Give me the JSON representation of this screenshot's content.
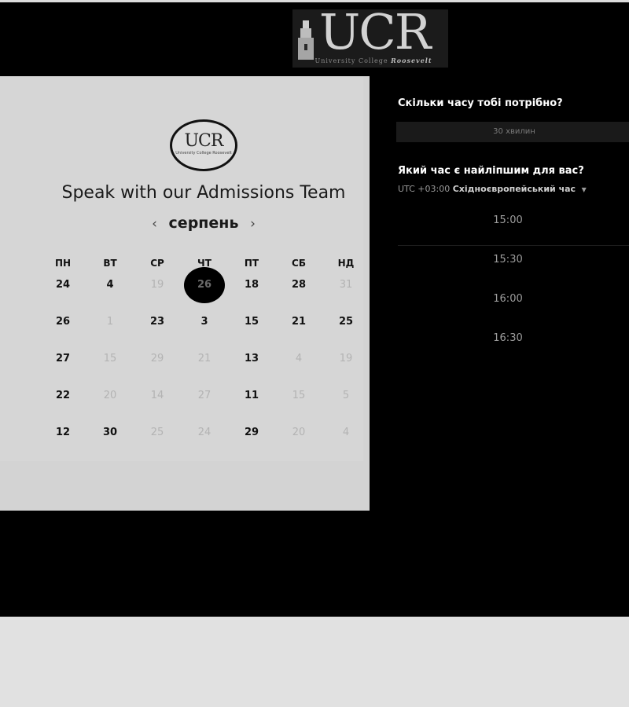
{
  "header": {
    "logo_text": "UCR",
    "logo_subtitle": "University College",
    "logo_subtitle_script": "Roosevelt"
  },
  "calendar": {
    "logo_text": "UCR",
    "logo_subtitle": "University College Roosevelt",
    "title": "Speak with our Admissions Team",
    "month": "серпень",
    "prev_icon": "chevron-left-icon",
    "next_icon": "chevron-right-icon",
    "prev_glyph": "‹",
    "next_glyph": "›",
    "weekdays": [
      "ПН",
      "ВТ",
      "СР",
      "ЧТ",
      "ПТ",
      "СБ",
      "НД"
    ],
    "weeks": [
      [
        {
          "d": "24",
          "a": true
        },
        {
          "d": "4",
          "a": true
        },
        {
          "d": "19",
          "a": false
        },
        {
          "d": "26",
          "a": true,
          "selected": true
        },
        {
          "d": "18",
          "a": true
        },
        {
          "d": "28",
          "a": true
        },
        {
          "d": "31",
          "a": false
        }
      ],
      [
        {
          "d": "26",
          "a": true
        },
        {
          "d": "1",
          "a": false
        },
        {
          "d": "23",
          "a": true
        },
        {
          "d": "3",
          "a": true
        },
        {
          "d": "15",
          "a": true
        },
        {
          "d": "21",
          "a": true
        },
        {
          "d": "25",
          "a": true
        }
      ],
      [
        {
          "d": "27",
          "a": true
        },
        {
          "d": "15",
          "a": false
        },
        {
          "d": "29",
          "a": false
        },
        {
          "d": "21",
          "a": false
        },
        {
          "d": "13",
          "a": true
        },
        {
          "d": "4",
          "a": false
        },
        {
          "d": "19",
          "a": false
        }
      ],
      [
        {
          "d": "22",
          "a": true
        },
        {
          "d": "20",
          "a": false
        },
        {
          "d": "14",
          "a": false
        },
        {
          "d": "27",
          "a": false
        },
        {
          "d": "11",
          "a": true
        },
        {
          "d": "15",
          "a": false
        },
        {
          "d": "5",
          "a": false
        }
      ],
      [
        {
          "d": "12",
          "a": true
        },
        {
          "d": "30",
          "a": true
        },
        {
          "d": "25",
          "a": false
        },
        {
          "d": "24",
          "a": false
        },
        {
          "d": "29",
          "a": true
        },
        {
          "d": "20",
          "a": false
        },
        {
          "d": "4",
          "a": false
        }
      ]
    ]
  },
  "scheduler": {
    "duration_question": "Скільки часу тобі потрібно?",
    "duration_value": "30 хвилин",
    "time_question": "Який час є найліпшим для вас?",
    "timezone_offset": "UTC +03:00",
    "timezone_name": "Східноєвропейський час",
    "timezone_caret": "▼",
    "slots": [
      "15:00",
      "15:30",
      "16:00",
      "16:30"
    ]
  },
  "colors": {
    "background": "#000000",
    "card": "#d6d6d6",
    "page": "#e1e1e1",
    "selected_day": "#000000"
  }
}
